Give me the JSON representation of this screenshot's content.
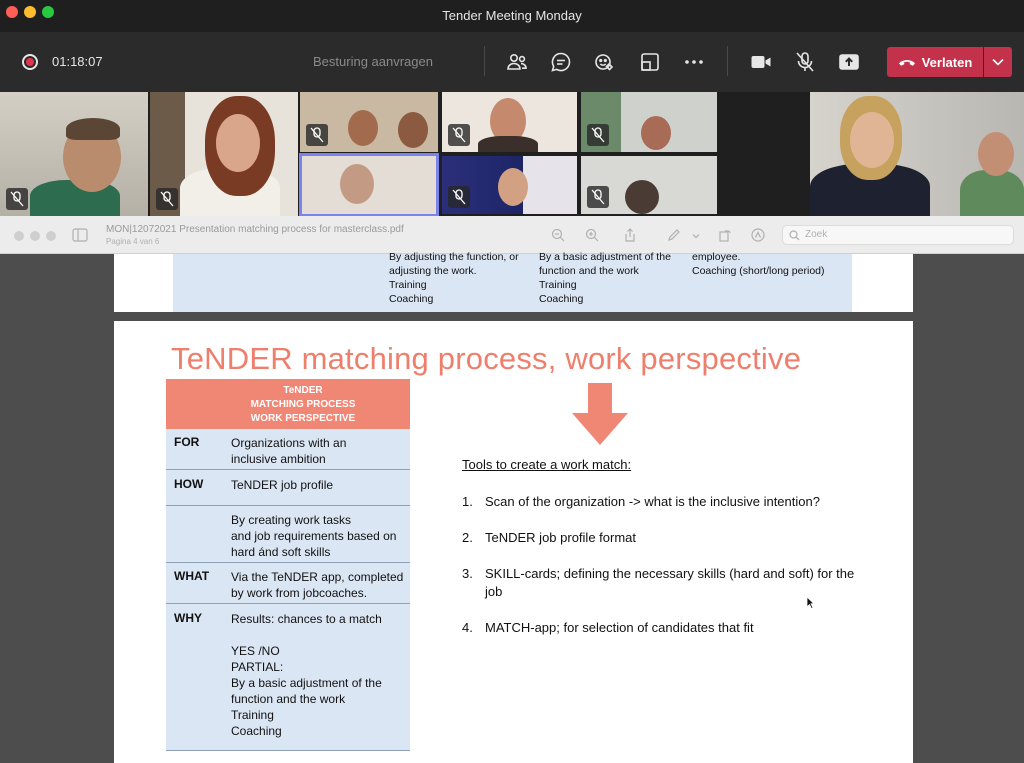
{
  "window": {
    "title": "Tender Meeting Monday"
  },
  "toolbar": {
    "timer": "01:18:07",
    "request_control": "Besturing aanvragen",
    "leave_label": "Verlaten",
    "icons": [
      "participants-icon",
      "chat-icon",
      "reactions-icon",
      "rooms-icon",
      "more-icon",
      "camera-icon",
      "mic-off-icon",
      "share-icon"
    ],
    "leave_color": "#c4314b"
  },
  "viewer": {
    "doc_title": "MON|12072021 Presentation matching process for masterclass.pdf",
    "doc_subtitle": "Pagina 4 van 6",
    "search_placeholder": "Zoek"
  },
  "page_prev": {
    "col1": [
      "By adjusting the function, or",
      "adjusting the work.",
      "Training",
      "Coaching"
    ],
    "col2": [
      "By a basic adjustment of the",
      "function and the work",
      "Training",
      "Coaching"
    ],
    "col3": [
      "employee.",
      "Coaching (short/long period)"
    ]
  },
  "slide": {
    "title": "TeNDER matching process, work perspective",
    "title_color": "#ee7f6c",
    "table_header": [
      "TeNDER",
      "MATCHING PROCESS",
      "WORK PERSPECTIVE"
    ],
    "rows": [
      {
        "key": "FOR",
        "lines": [
          "Organizations with an",
          "inclusive ambition"
        ]
      },
      {
        "key": "HOW",
        "lines": [
          "TeNDER job profile"
        ]
      },
      {
        "key": "",
        "lines": [
          "By creating work tasks",
          "and job requirements based on",
          "hard ánd soft skills"
        ]
      },
      {
        "key": "WHAT",
        "lines": [
          "Via the TeNDER app, completed",
          "by work from jobcoaches."
        ]
      },
      {
        "key": "WHY",
        "lines": [
          "Results: chances to a match",
          "",
          "YES /NO",
          "PARTIAL:",
          "By a basic adjustment of the",
          "function and the work",
          "Training",
          "Coaching"
        ]
      }
    ],
    "tools_title": "Tools to create a work match:",
    "tools": [
      {
        "num": "1.",
        "lines": [
          "Scan of the organization -> what is the inclusive intention?"
        ]
      },
      {
        "num": "2.",
        "lines": [
          "TeNDER job profile format"
        ]
      },
      {
        "num": "3.",
        "lines": [
          "SKILL-cards; defining the necessary skills (hard and soft) for the",
          "job"
        ]
      },
      {
        "num": "4.",
        "lines": [
          "MATCH-app; for selection of candidates that fit"
        ]
      }
    ]
  }
}
